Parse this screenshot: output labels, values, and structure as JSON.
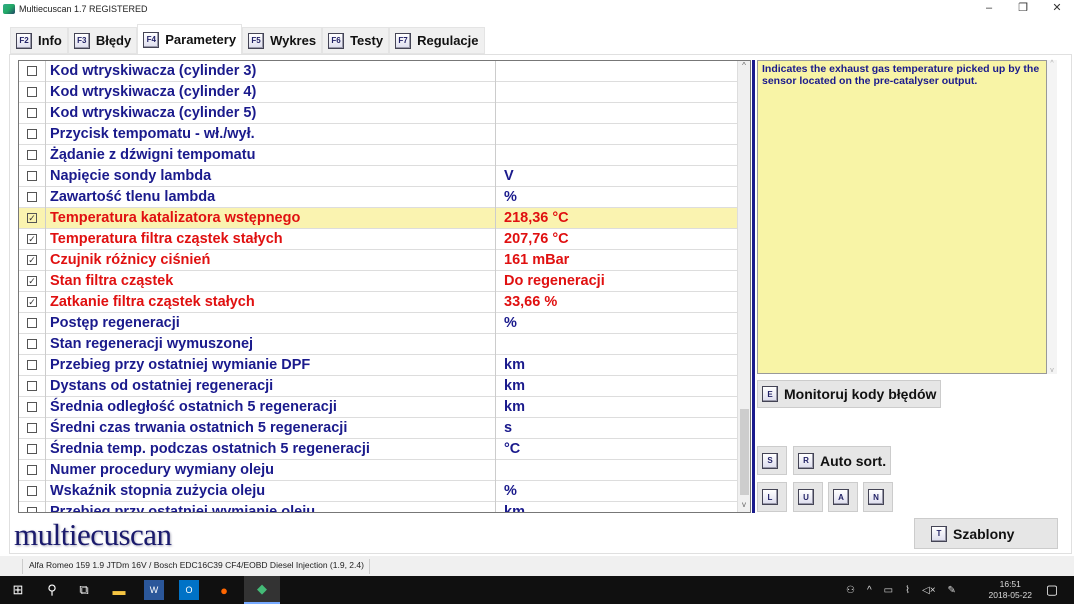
{
  "window": {
    "title": "Multiecuscan 1.7 REGISTERED",
    "minimize": "–",
    "maximize": "❐",
    "close": "✕"
  },
  "tabs": [
    {
      "key": "F2",
      "label": "Info"
    },
    {
      "key": "F3",
      "label": "Błędy"
    },
    {
      "key": "F4",
      "label": "Parametery"
    },
    {
      "key": "F5",
      "label": "Wykres"
    },
    {
      "key": "F6",
      "label": "Testy"
    },
    {
      "key": "F7",
      "label": "Regulacje"
    }
  ],
  "rows": [
    {
      "name": "Kod wtryskiwacza (cylinder 3)",
      "value": "",
      "checked": false
    },
    {
      "name": "Kod wtryskiwacza (cylinder 4)",
      "value": "",
      "checked": false
    },
    {
      "name": "Kod wtryskiwacza (cylinder 5)",
      "value": "",
      "checked": false
    },
    {
      "name": "Przycisk tempomatu - wł./wył.",
      "value": "",
      "checked": false
    },
    {
      "name": "Żądanie z dźwigni tempomatu",
      "value": "",
      "checked": false
    },
    {
      "name": "Napięcie sondy lambda",
      "value": "V",
      "checked": false
    },
    {
      "name": "Zawartość tlenu lambda",
      "value": "%",
      "checked": false
    },
    {
      "name": "Temperatura katalizatora wstępnego",
      "value": "218,36 °C",
      "checked": true,
      "selected": true
    },
    {
      "name": "Temperatura filtra cząstek stałych",
      "value": "207,76 °C",
      "checked": true
    },
    {
      "name": "Czujnik różnicy ciśnień",
      "value": "161 mBar",
      "checked": true
    },
    {
      "name": "Stan filtra cząstek",
      "value": "Do regeneracji",
      "checked": true
    },
    {
      "name": "Zatkanie filtra cząstek stałych",
      "value": "33,66 %",
      "checked": true
    },
    {
      "name": "Postęp regeneracji",
      "value": "%",
      "checked": false
    },
    {
      "name": "Stan regeneracji wymuszonej",
      "value": "",
      "checked": false
    },
    {
      "name": "Przebieg przy ostatniej wymianie DPF",
      "value": "km",
      "checked": false
    },
    {
      "name": "Dystans od ostatniej regeneracji",
      "value": "km",
      "checked": false
    },
    {
      "name": "Średnia odległość ostatnich 5 regeneracji",
      "value": "km",
      "checked": false
    },
    {
      "name": "Średni czas trwania ostatnich 5 regeneracji",
      "value": "s",
      "checked": false
    },
    {
      "name": "Średnia temp. podczas ostatnich 5 regeneracji",
      "value": "°C",
      "checked": false
    },
    {
      "name": "Numer procedury wymiany oleju",
      "value": "",
      "checked": false
    },
    {
      "name": "Wskaźnik stopnia zużycia oleju",
      "value": "%",
      "checked": false
    },
    {
      "name": "Przebieg przy ostatniej wymianie oleju",
      "value": "km",
      "checked": false
    }
  ],
  "info_text": "Indicates the exhaust gas temperature picked up by the sensor located on the pre-catalyser output.",
  "buttons": {
    "monitor": {
      "key": "E",
      "label": "Monitoruj kody błędów"
    },
    "s": {
      "key": "S"
    },
    "autosort": {
      "key": "R",
      "label": "Auto sort."
    },
    "l": {
      "key": "L"
    },
    "u": {
      "key": "U"
    },
    "a": {
      "key": "A"
    },
    "n": {
      "key": "N"
    },
    "templates": {
      "key": "T",
      "label": "Szablony"
    }
  },
  "logo": "multiecuscan",
  "status": "Alfa Romeo 159 1.9 JTDm 16V / Bosch EDC16C39 CF4/EOBD Diesel Injection (1.9, 2.4)",
  "taskbar": {
    "time": "16:51",
    "date": "2018-05-22"
  },
  "colors": {
    "accent": "#1a1a8c",
    "active": "#e01010",
    "selected_bg": "#faf3b0",
    "info_bg": "#f8f4a6"
  }
}
